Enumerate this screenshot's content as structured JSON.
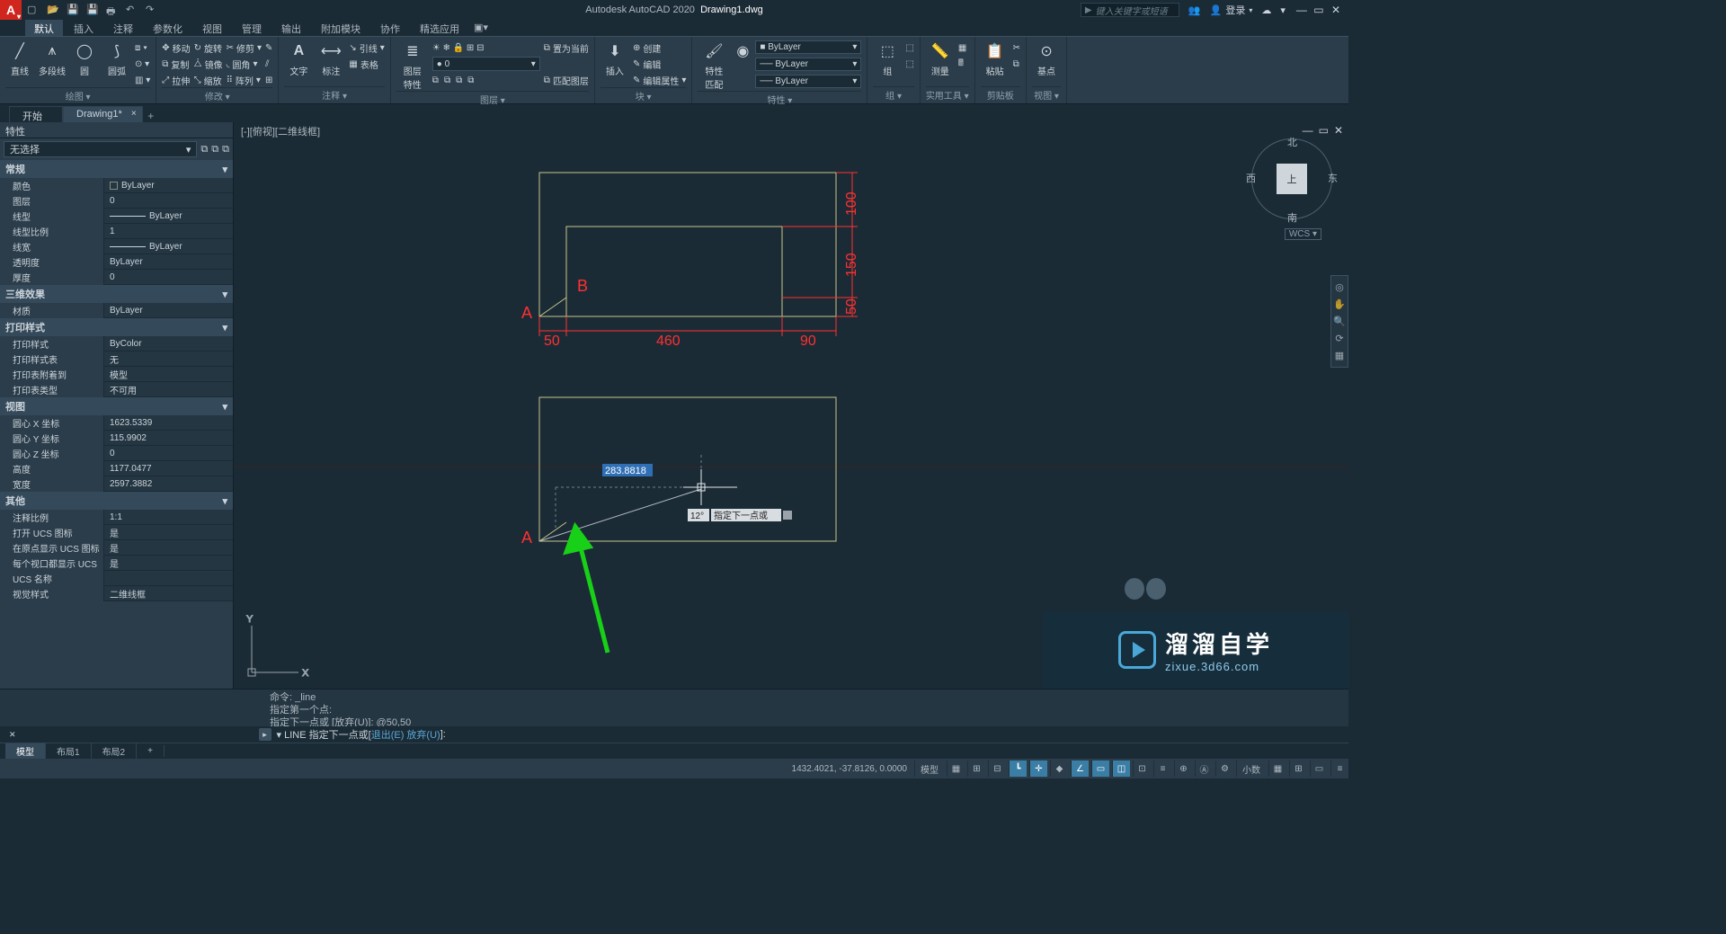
{
  "title": {
    "app": "Autodesk AutoCAD 2020",
    "file": "Drawing1.dwg"
  },
  "search_placeholder": "键入关键字或短语",
  "login_label": "登录",
  "menu_tabs": [
    "默认",
    "插入",
    "注释",
    "参数化",
    "视图",
    "管理",
    "输出",
    "附加模块",
    "协作",
    "精选应用"
  ],
  "menu_active": 0,
  "ribbon": {
    "draw": {
      "title": "绘图 ▾",
      "line": "直线",
      "polyline": "多段线",
      "circle": "圆",
      "arc": "圆弧"
    },
    "modify": {
      "title": "修改 ▾",
      "r1": [
        "移动",
        "旋转",
        "修剪"
      ],
      "r2": [
        "复制",
        "镜像",
        "圆角"
      ],
      "r3": [
        "拉伸",
        "缩放",
        "阵列"
      ]
    },
    "annot": {
      "title": "注释 ▾",
      "text": "文字",
      "dim": "标注",
      "leader": "引线",
      "table": "表格"
    },
    "layer": {
      "title": "图层 ▾",
      "main": "图层\n特性",
      "row1": "置为当前",
      "row2": "匹配图层"
    },
    "block": {
      "title": "块 ▾",
      "insert": "插入",
      "r1": "创建",
      "r2": "编辑",
      "r3": "编辑属性"
    },
    "props": {
      "title": "特性 ▾",
      "main": "特性\n匹配",
      "bylayer": "ByLayer"
    },
    "group": {
      "title": "组 ▾",
      "main": "组"
    },
    "util": {
      "title": "实用工具 ▾",
      "main": "测量"
    },
    "clip": {
      "title": "剪贴板",
      "main": "粘贴"
    },
    "view": {
      "title": "视图 ▾",
      "main": "基点"
    }
  },
  "filetabs": {
    "start": "开始",
    "file": "Drawing1*"
  },
  "properties": {
    "palette_title": "特性",
    "noselection": "无选择",
    "cat_general": "常规",
    "general": [
      [
        "颜色",
        "ByLayer",
        "square"
      ],
      [
        "图层",
        "0"
      ],
      [
        "线型",
        "ByLayer",
        "line"
      ],
      [
        "线型比例",
        "1"
      ],
      [
        "线宽",
        "ByLayer",
        "line"
      ],
      [
        "透明度",
        "ByLayer"
      ],
      [
        "厚度",
        "0"
      ]
    ],
    "cat_3d": "三维效果",
    "threeD": [
      [
        "材质",
        "ByLayer"
      ]
    ],
    "cat_plot": "打印样式",
    "plot": [
      [
        "打印样式",
        "ByColor"
      ],
      [
        "打印样式表",
        "无"
      ],
      [
        "打印表附着到",
        "模型"
      ],
      [
        "打印表类型",
        "不可用"
      ]
    ],
    "cat_view": "视图",
    "view": [
      [
        "圆心 X 坐标",
        "1623.5339"
      ],
      [
        "圆心 Y 坐标",
        "115.9902"
      ],
      [
        "圆心 Z 坐标",
        "0"
      ],
      [
        "高度",
        "1177.0477"
      ],
      [
        "宽度",
        "2597.3882"
      ]
    ],
    "cat_misc": "其他",
    "misc": [
      [
        "注释比例",
        "1:1"
      ],
      [
        "打开 UCS 图标",
        "是"
      ],
      [
        "在原点显示 UCS 图标",
        "是"
      ],
      [
        "每个视口都显示 UCS",
        "是"
      ],
      [
        "UCS 名称",
        ""
      ],
      [
        "视觉样式",
        "二维线框"
      ]
    ]
  },
  "viewport_label": "[-][俯视][二维线框]",
  "viewcube": {
    "top": "上",
    "n": "北",
    "s": "南",
    "e": "东",
    "w": "西",
    "wcs": "WCS ▾"
  },
  "drawing": {
    "labelA": "A",
    "labelB": "B",
    "dims": {
      "d50a": "50",
      "d460": "460",
      "d90": "90",
      "d50b": "50",
      "d150": "150",
      "d100": "100"
    },
    "dyn_dist": "283.8818",
    "dyn_angle": "12°",
    "dyn_prompt": "指定下一点或"
  },
  "cmd_history": [
    "命令: _line",
    "指定第一个点:",
    "指定下一点或 [放弃(U)]: @50,50"
  ],
  "cmd_prompt_pre": "LINE 指定下一点或[",
  "cmd_prompt_opts": "退出(E) 放弃(U)",
  "cmd_prompt_post": "]: ",
  "layout_tabs": [
    "模型",
    "布局1",
    "布局2"
  ],
  "status_coords": "1432.4021, -37.8126, 0.0000",
  "status_model": "模型",
  "status_scale": "小数",
  "watermark": {
    "cn": "溜溜自学",
    "en": "zixue.3d66.com"
  }
}
